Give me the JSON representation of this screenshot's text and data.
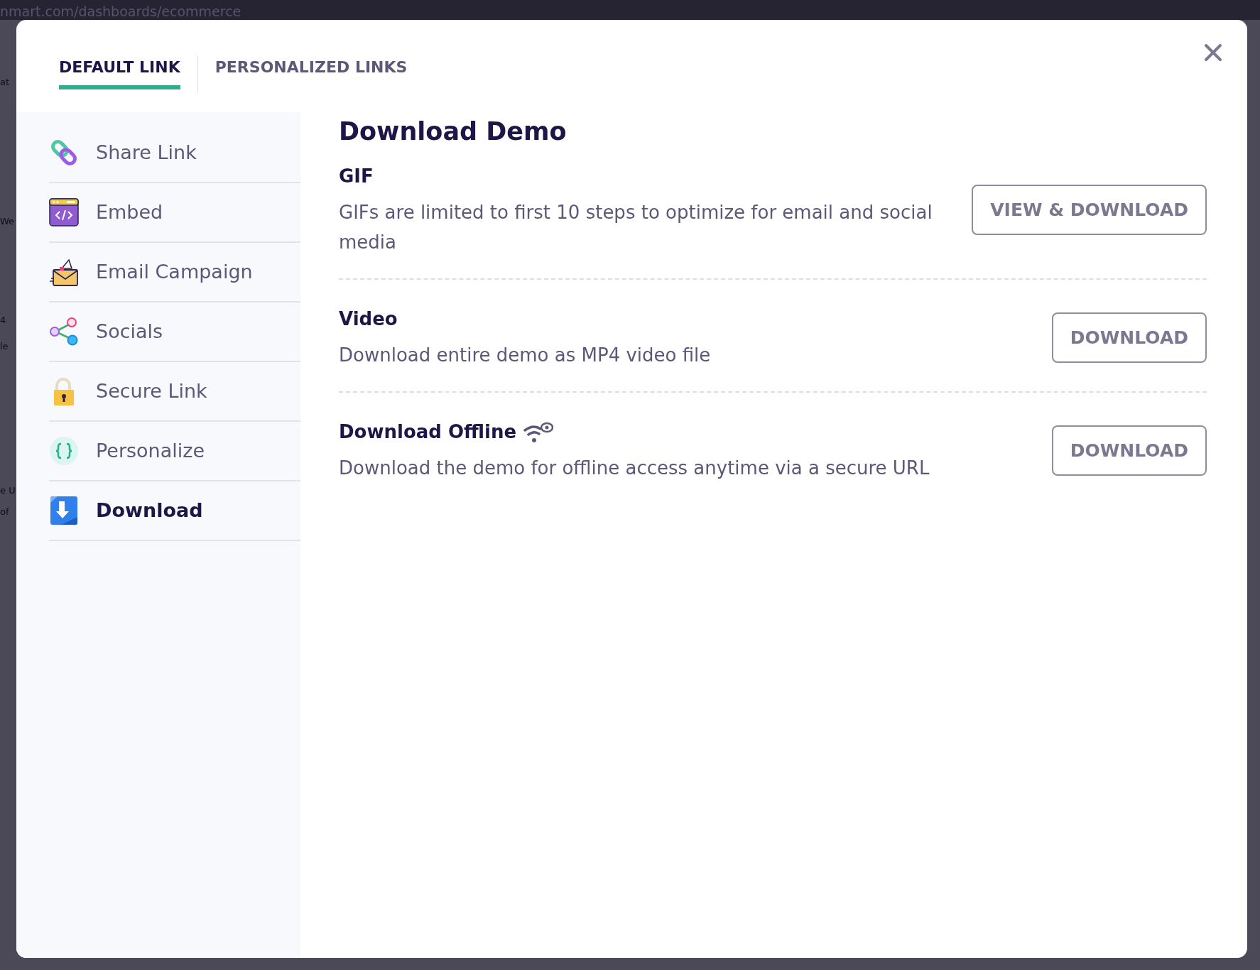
{
  "browser": {
    "url": "nmart.com/dashboards/ecommerce"
  },
  "background_fragments": [
    "at",
    "We",
    "4",
    "le",
    "e U",
    "of"
  ],
  "tabs": [
    {
      "label": "DEFAULT LINK",
      "selected": true
    },
    {
      "label": "PERSONALIZED LINKS",
      "selected": false
    }
  ],
  "sidebar": {
    "items": [
      {
        "label": "Share Link",
        "selected": false
      },
      {
        "label": "Embed",
        "selected": false
      },
      {
        "label": "Email Campaign",
        "selected": false
      },
      {
        "label": "Socials",
        "selected": false
      },
      {
        "label": "Secure Link",
        "selected": false
      },
      {
        "label": "Personalize",
        "selected": false
      },
      {
        "label": "Download",
        "selected": true
      }
    ]
  },
  "content": {
    "title": "Download Demo",
    "sections": [
      {
        "kind": "gif",
        "title": "GIF",
        "description": "GIFs are limited to first 10 steps to optimize for email and social media",
        "button": "VIEW & DOWNLOAD"
      },
      {
        "kind": "video",
        "title": "Video",
        "description": "Download entire demo as MP4 video file",
        "button": "DOWNLOAD"
      },
      {
        "kind": "offline",
        "title": "Download Offline",
        "description": "Download the demo for offline access anytime via a secure URL",
        "button": "DOWNLOAD"
      }
    ]
  }
}
